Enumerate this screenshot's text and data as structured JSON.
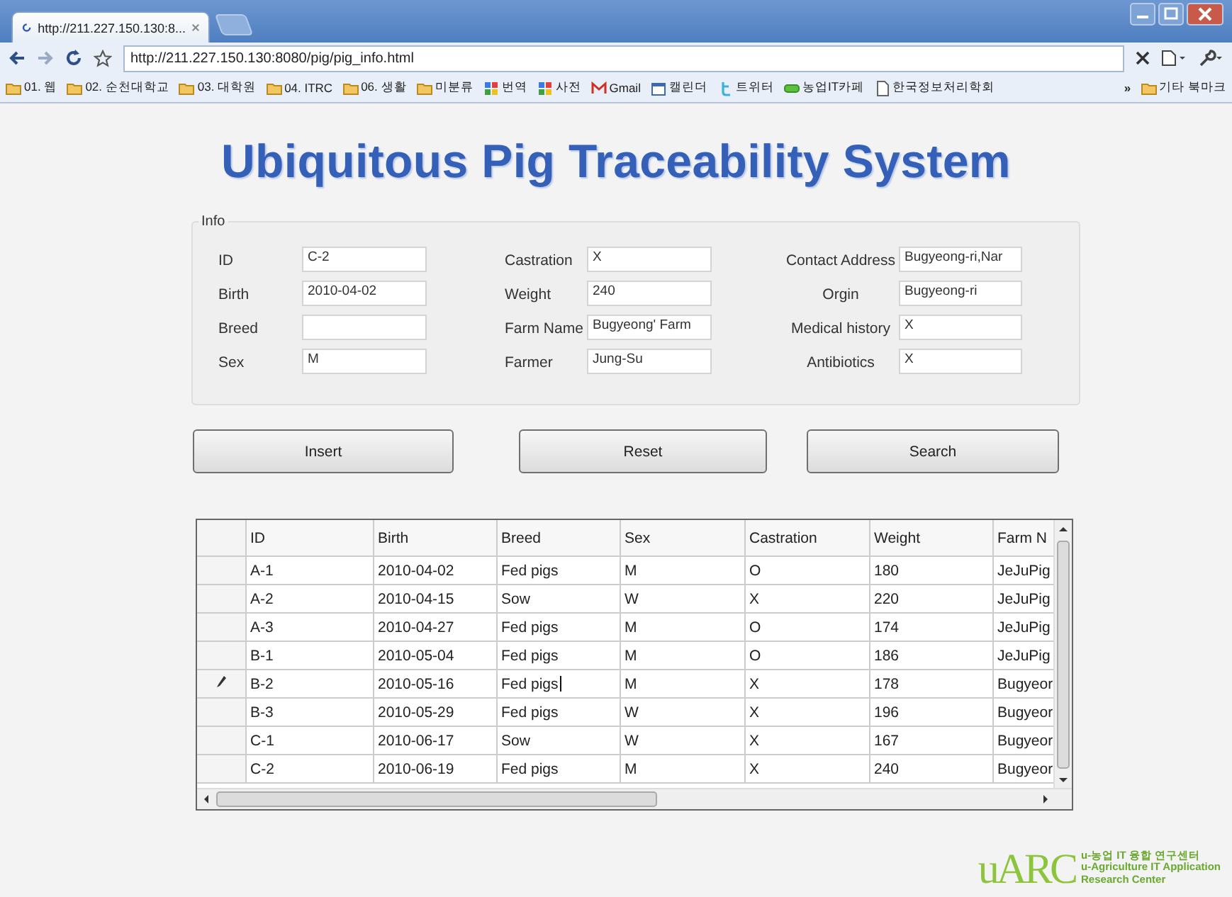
{
  "browser": {
    "tab_title": "http://211.227.150.130:8...",
    "tab_loading": true,
    "url": "http://211.227.150.130:8080/pig/pig_info.html",
    "bookmarks": [
      {
        "label": "01. 웹",
        "kind": "folder"
      },
      {
        "label": "02. 순천대학교",
        "kind": "folder"
      },
      {
        "label": "03. 대학원",
        "kind": "folder"
      },
      {
        "label": "04. ITRC",
        "kind": "folder"
      },
      {
        "label": "06. 생활",
        "kind": "folder"
      },
      {
        "label": "미분류",
        "kind": "folder"
      },
      {
        "label": "번역",
        "kind": "app"
      },
      {
        "label": "사전",
        "kind": "app"
      },
      {
        "label": "Gmail",
        "kind": "mail"
      },
      {
        "label": "캘린더",
        "kind": "calendar"
      },
      {
        "label": "트위터",
        "kind": "twitter"
      },
      {
        "label": "농업IT카페",
        "kind": "cafe"
      },
      {
        "label": "한국정보처리학회",
        "kind": "page"
      }
    ],
    "more": "»",
    "other_bookmarks": "기타 북마크"
  },
  "page_title": "Ubiquitous Pig Traceability System",
  "info": {
    "legend": "Info",
    "columns": [
      [
        {
          "label": "ID",
          "value": "C-2"
        },
        {
          "label": "Birth",
          "value": "2010-04-02"
        },
        {
          "label": "Breed"
        },
        {
          "label": "Sex",
          "value": "M"
        }
      ],
      [
        {
          "label": "Castration",
          "value": "X"
        },
        {
          "label": "Weight",
          "value": "240"
        },
        {
          "label": "Farm Name",
          "value": "Bugyeong' Farm"
        },
        {
          "label": "Farmer",
          "value": "Jung-Su"
        }
      ],
      [
        {
          "label": "Contact Address",
          "value": "Bugyeong-ri,Nar"
        },
        {
          "label": "Orgin",
          "value": "Bugyeong-ri"
        },
        {
          "label": "Medical history",
          "value": "X"
        },
        {
          "label": "Antibiotics",
          "value": "X"
        }
      ]
    ]
  },
  "buttons": [
    "Insert",
    "Reset",
    "Search"
  ],
  "table": {
    "columns": [
      "ID",
      "Birth",
      "Breed",
      "Sex",
      "Castration",
      "Weight",
      "Farm N"
    ],
    "rows": [
      {
        "cells": [
          "A-1",
          "2010-04-02",
          "Fed pigs",
          "M",
          "O",
          "180",
          "JeJuPig"
        ],
        "editing": false
      },
      {
        "cells": [
          "A-2",
          "2010-04-15",
          "Sow",
          "W",
          "X",
          "220",
          "JeJuPig"
        ],
        "editing": false
      },
      {
        "cells": [
          "A-3",
          "2010-04-27",
          "Fed pigs",
          "M",
          "O",
          "174",
          "JeJuPig"
        ],
        "editing": false
      },
      {
        "cells": [
          "B-1",
          "2010-05-04",
          "Fed pigs",
          "M",
          "O",
          "186",
          "JeJuPig"
        ],
        "editing": false
      },
      {
        "cells": [
          "B-2",
          "2010-05-16",
          "Fed pigs",
          "M",
          "X",
          "178",
          "Bugyeor"
        ],
        "editing": true
      },
      {
        "cells": [
          "B-3",
          "2010-05-29",
          "Fed pigs",
          "W",
          "X",
          "196",
          "Bugyeor"
        ],
        "editing": false
      },
      {
        "cells": [
          "C-1",
          "2010-06-17",
          "Sow",
          "W",
          "X",
          "167",
          "Bugyeor"
        ],
        "editing": false
      },
      {
        "cells": [
          "C-2",
          "2010-06-19",
          "Fed pigs",
          "M",
          "X",
          "240",
          "Bugyeor"
        ],
        "editing": false
      }
    ]
  },
  "logo": {
    "mark": "uARC",
    "korean": "u-농업 IT 융합 연구센터",
    "english_1": "u-Agriculture IT Application",
    "english_2": "Research Center"
  }
}
